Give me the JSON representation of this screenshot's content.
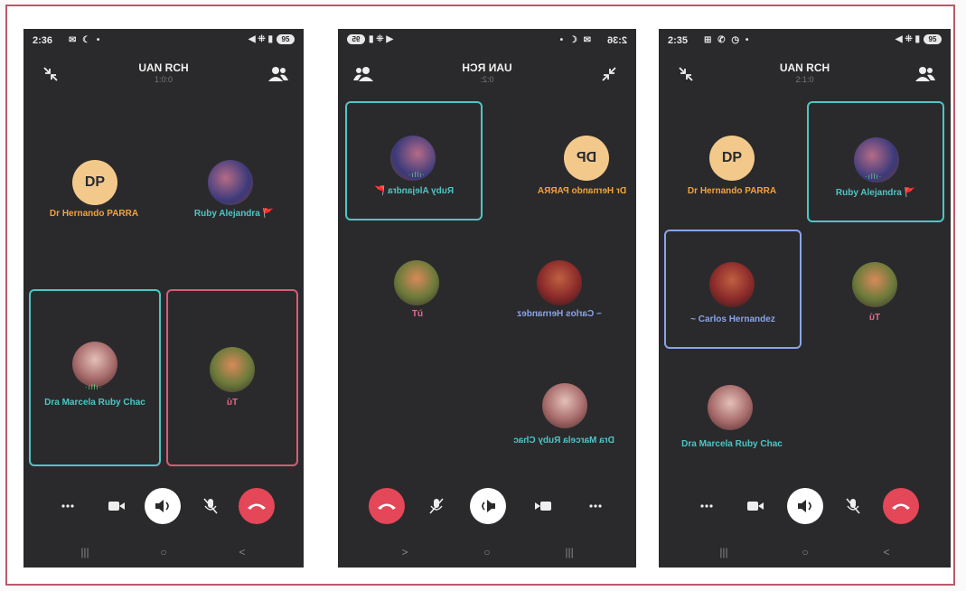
{
  "colors": {
    "background": "#2a2a2c",
    "end_call": "#e44758",
    "teal_border": "#4fc5c5",
    "pink_border": "#d85b78",
    "blue_border": "#8aa4e8",
    "dp_avatar": "#f3c98b"
  },
  "phones": [
    {
      "status": {
        "time": "2:36",
        "battery": "95"
      },
      "call": {
        "title": "UAN RCH",
        "subtitle": "1:0:0"
      },
      "participants": {
        "dp_initials": "DP",
        "hernando": "Dr Hernando PARRA",
        "ruby": "Ruby Alejandra 🚩",
        "marcela": "Dra Marcela Ruby Chac",
        "tu": "Tú"
      }
    },
    {
      "status": {
        "time": "2:36",
        "battery": "95"
      },
      "call": {
        "title": "UAN RCH",
        "subtitle": "0:2:"
      },
      "participants": {
        "dp_initials": "DP",
        "hernando": "Dr Hernando PARRA",
        "ruby": "Ruby Alejandra 🚩",
        "carlos": "~ Carlos Hernandez",
        "tu": "Tú",
        "marcela": "Dra Marcela Ruby Chac"
      }
    },
    {
      "status": {
        "time": "2:35",
        "battery": "95"
      },
      "call": {
        "title": "UAN RCH",
        "subtitle": "2:1:0"
      },
      "participants": {
        "dp_initials": "DP",
        "hernando": "Dr Hernando PARRA",
        "ruby": "Ruby Alejandra 🚩",
        "carlos": "~ Carlos Hernandez",
        "tu": "Tú",
        "marcela": "Dra Marcela Ruby Chac"
      }
    }
  ],
  "controls": {
    "more": "more-icon",
    "video": "video-camera-icon",
    "speaker": "speaker-icon",
    "mic": "mic-off-icon",
    "end": "end-call-icon"
  },
  "nav": {
    "recent": "|||",
    "home": "○",
    "back": "<"
  }
}
